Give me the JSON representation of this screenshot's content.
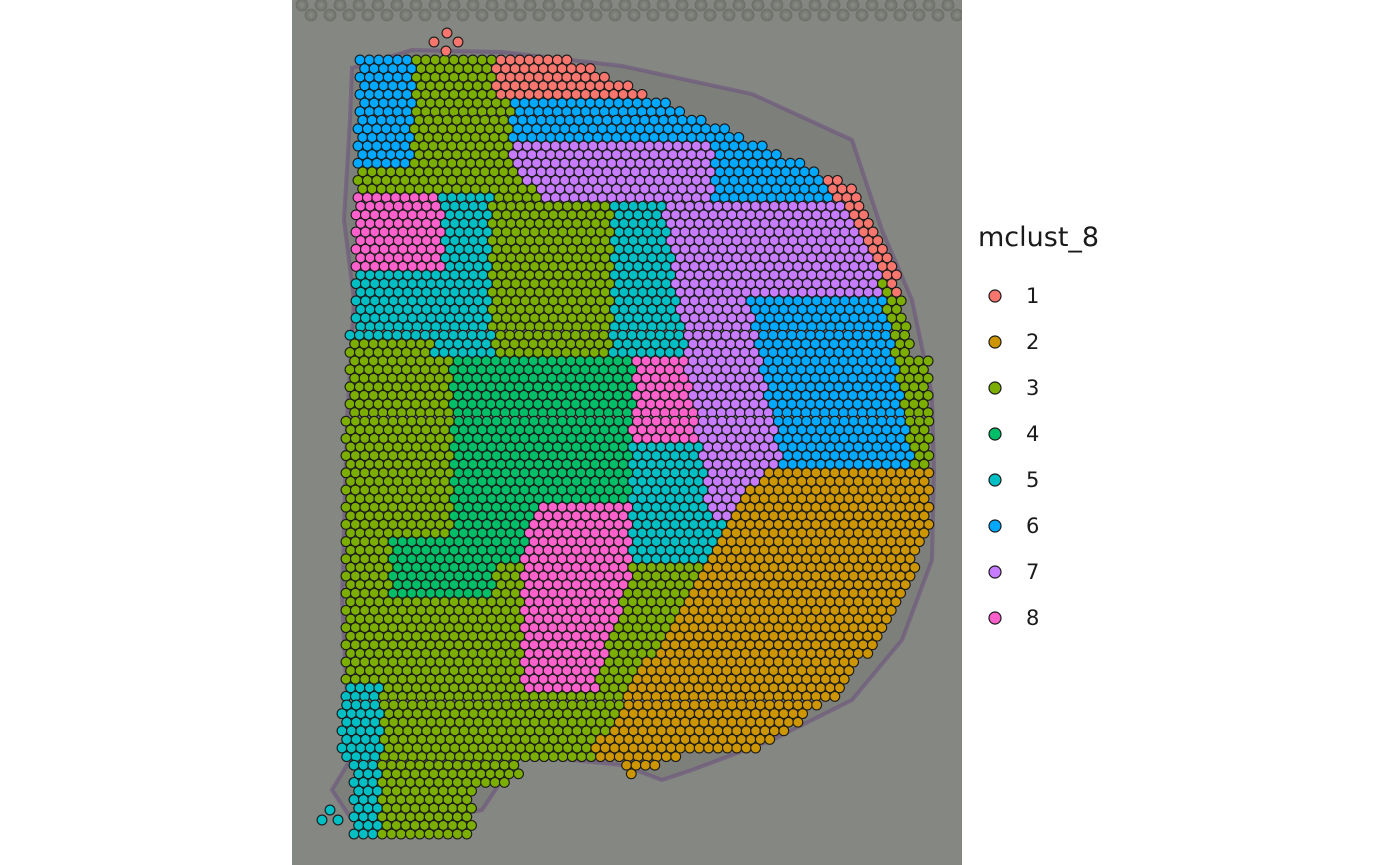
{
  "chart_data": {
    "type": "scatter",
    "title": "",
    "xlabel": "",
    "ylabel": "",
    "grid": false,
    "background": "tissue-histology-image",
    "legend_position": "right",
    "legend": {
      "title": "mclust_8",
      "entries": [
        {
          "label": "1",
          "color": "#F8766D"
        },
        {
          "label": "2",
          "color": "#CD9600"
        },
        {
          "label": "3",
          "color": "#7CAE00"
        },
        {
          "label": "4",
          "color": "#00BE67"
        },
        {
          "label": "5",
          "color": "#00BFC4"
        },
        {
          "label": "6",
          "color": "#00A9FF"
        },
        {
          "label": "7",
          "color": "#C77CFF"
        },
        {
          "label": "8",
          "color": "#FF61CC"
        }
      ]
    },
    "point_outline_color": "#1a1a1a"
  }
}
